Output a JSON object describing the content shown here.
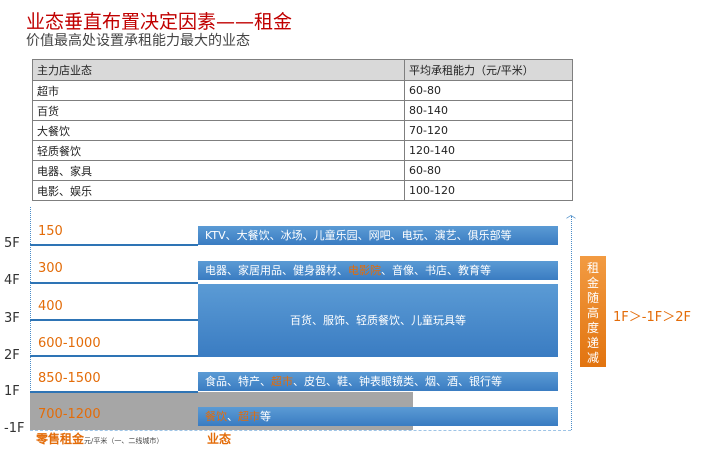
{
  "header": {
    "title": "业态垂直布置决定因素——租金",
    "subtitle": "价值最高处设置承租能力最大的业态"
  },
  "table": {
    "columns": [
      "主力店业态",
      "平均承租能力（元/平米）"
    ],
    "rows": [
      [
        "超市",
        "60-80"
      ],
      [
        "百货",
        "80-140"
      ],
      [
        "大餐饮",
        "70-120"
      ],
      [
        "轻质餐饮",
        "120-140"
      ],
      [
        "电器、家具",
        "60-80"
      ],
      [
        "电影、娱乐",
        "100-120"
      ]
    ]
  },
  "floors": [
    "5F",
    "4F",
    "3F",
    "2F",
    "1F",
    "-1F"
  ],
  "rents": [
    "150",
    "300",
    "400",
    "600-1000",
    "850-1500",
    "700-1200"
  ],
  "bars": {
    "f5": "KTV、大餐饮、冰场、儿童乐园、网吧、电玩、演艺、俱乐部等",
    "f4_a": "电器、家居用品、健身器材、",
    "f4_hl": "电影院",
    "f4_b": "、音像、书店、教育等",
    "f23": "百货、服饰、轻质餐饮、儿童玩具等",
    "f1_a": "食品、特产、",
    "f1_hl": "超市",
    "f1_b": "、皮包、鞋、钟表眼镜类、烟、酒、银行等",
    "fb1_hl1": "餐饮",
    "fb1_sep": "、",
    "fb1_hl2": "超市",
    "fb1_b": "等"
  },
  "side_label": [
    "租",
    "金",
    "随",
    "高",
    "度",
    "递",
    "减"
  ],
  "comparison": "1F＞-1F＞2F",
  "footer": {
    "rent_label": "零售租金",
    "rent_unit": "元/平米（一、二线城市）",
    "type_label": "业态"
  },
  "colors": {
    "title": "#c00000",
    "accent": "#e36c09",
    "bar": "#5b9bd5",
    "line": "#2e74b5"
  }
}
